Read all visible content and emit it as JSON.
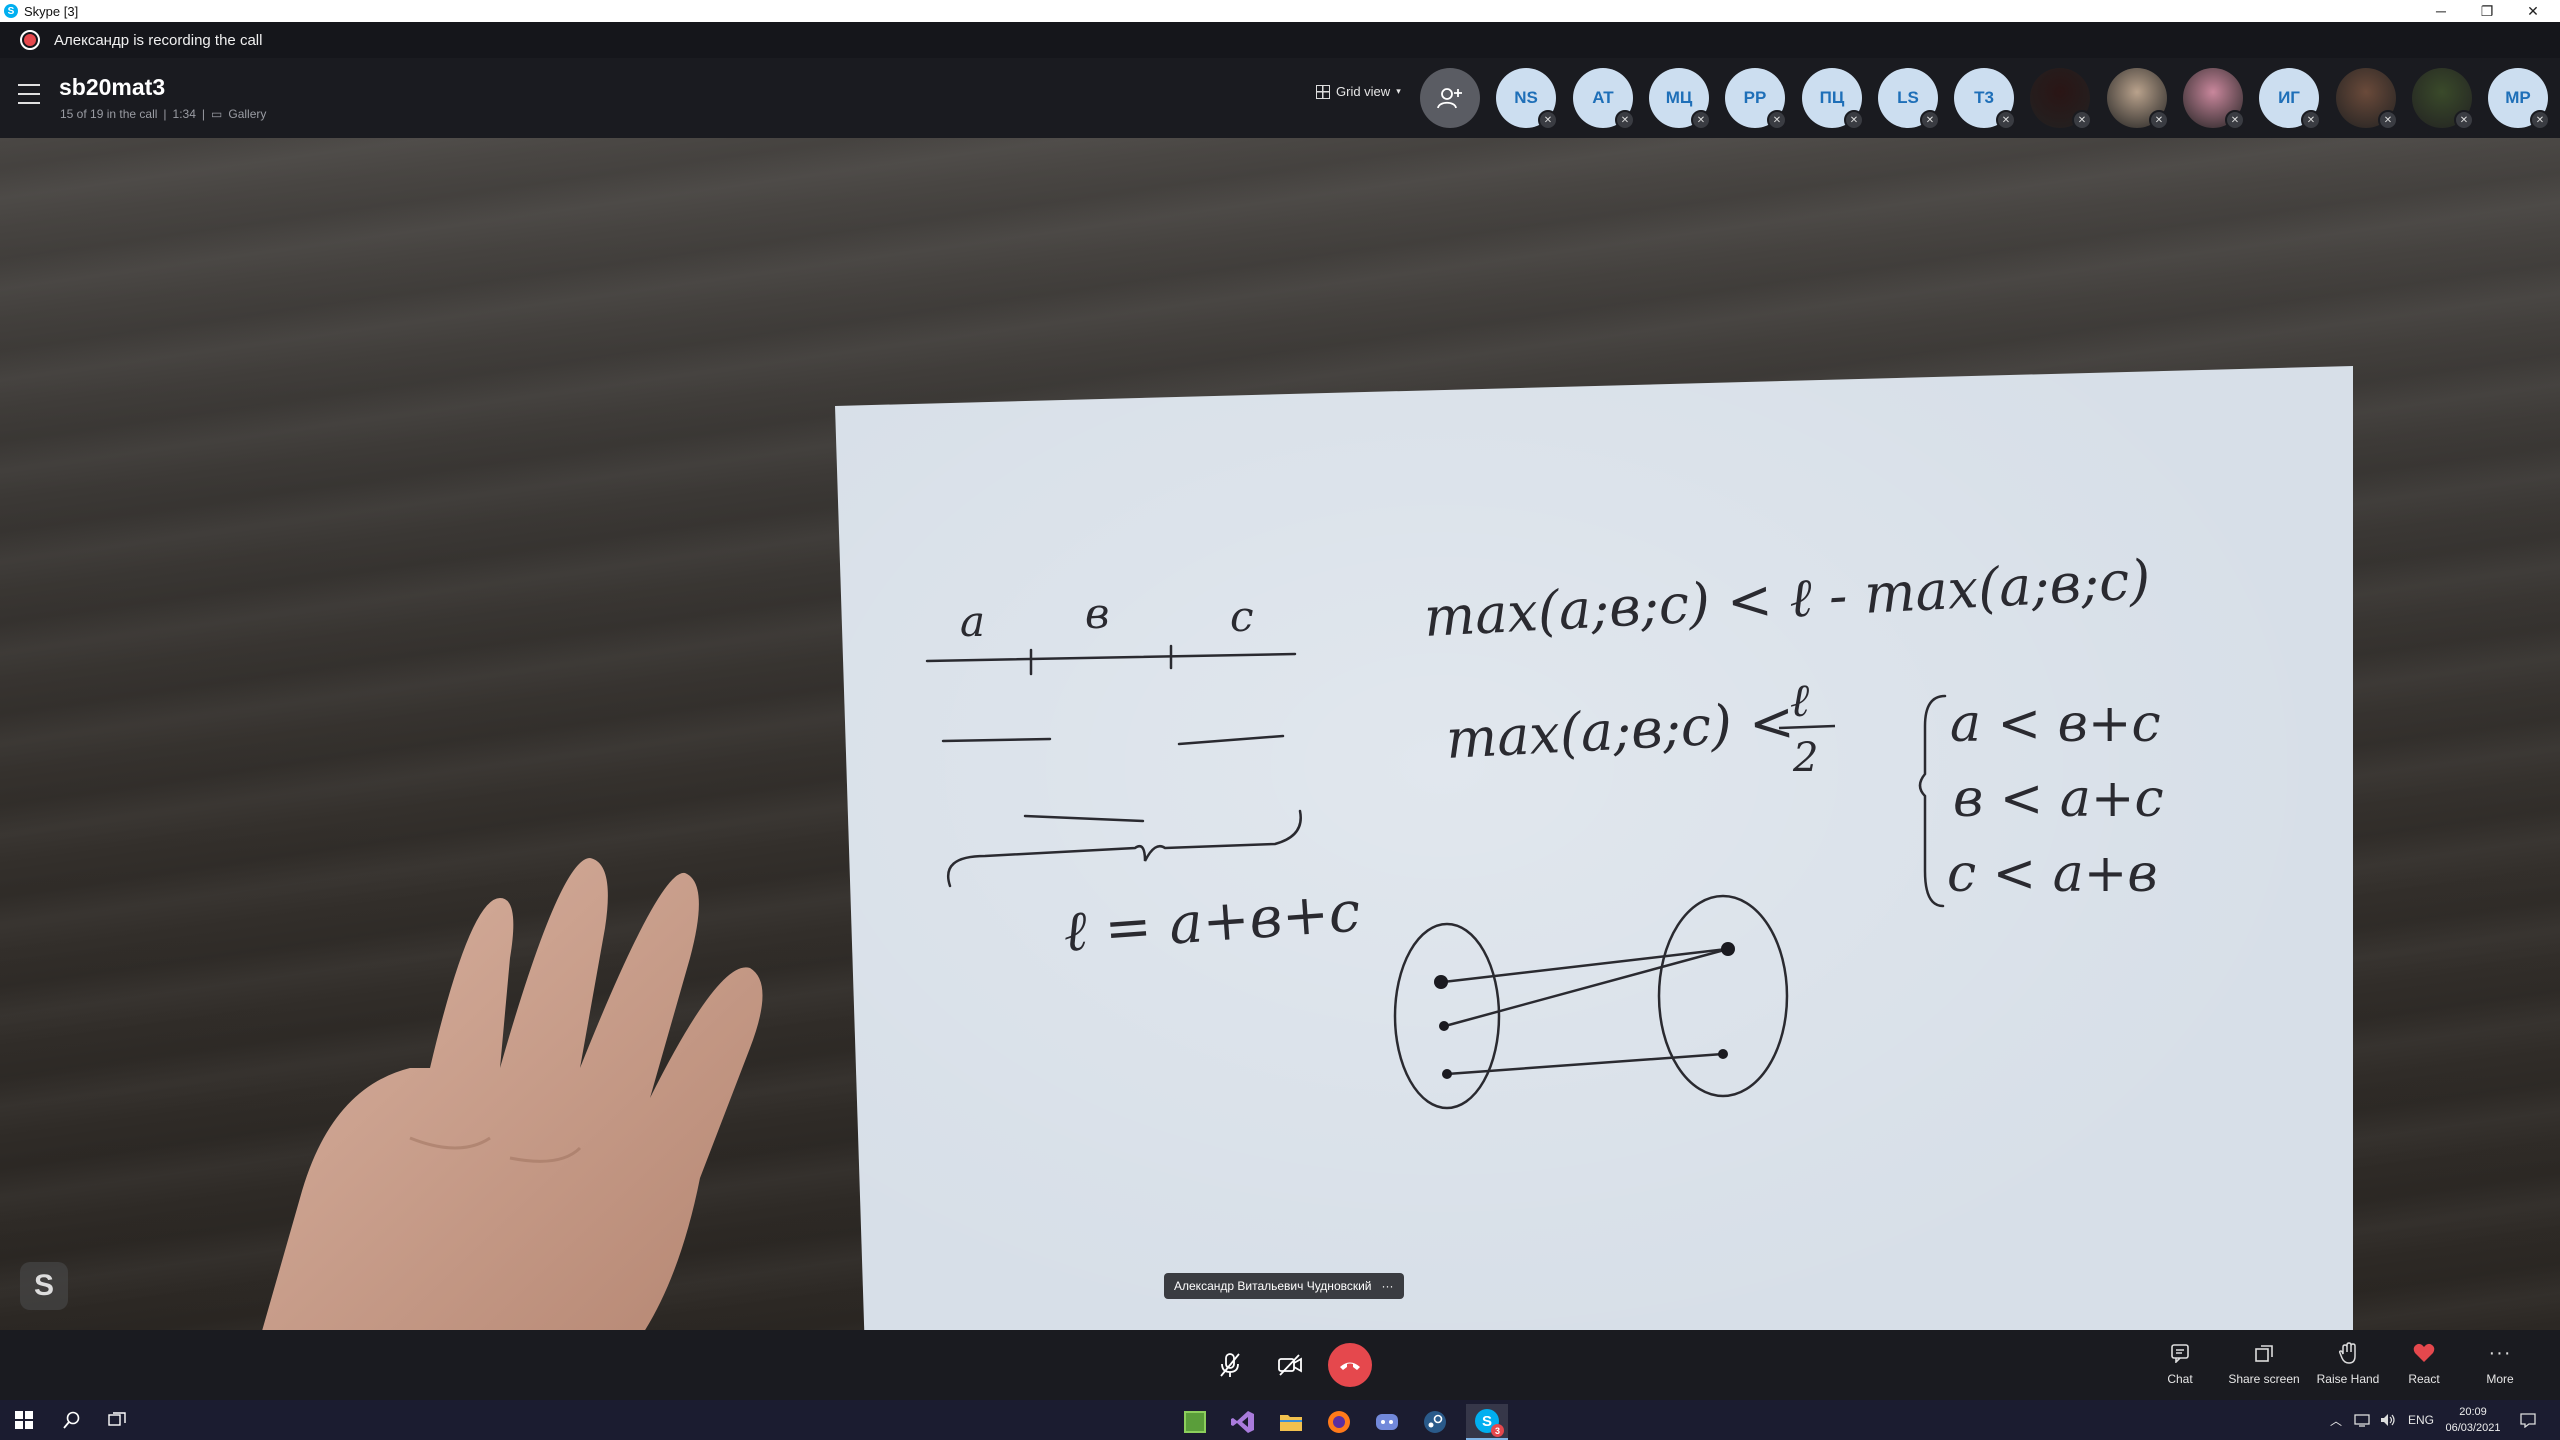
{
  "window": {
    "title": "Skype [3]",
    "minimize_glyph": "─",
    "restore_glyph": "❐",
    "close_glyph": "✕"
  },
  "recording_banner": {
    "text": "Александр is recording the call"
  },
  "call": {
    "title": "sb20mat3",
    "participants_status": "15 of 19 in the call",
    "duration": "1:34",
    "view_mode": "Gallery",
    "grid_view_label": "Grid view",
    "participants": [
      {
        "initials": "NS",
        "type": "initials"
      },
      {
        "initials": "AT",
        "type": "initials"
      },
      {
        "initials": "МЦ",
        "type": "initials"
      },
      {
        "initials": "PP",
        "type": "initials"
      },
      {
        "initials": "ПЦ",
        "type": "initials"
      },
      {
        "initials": "LS",
        "type": "initials"
      },
      {
        "initials": "T3",
        "type": "initials"
      },
      {
        "initials": "",
        "type": "photo",
        "color": "#2a1515"
      },
      {
        "initials": "",
        "type": "photo",
        "color": "#b9a28c"
      },
      {
        "initials": "",
        "type": "photo",
        "color": "#c9879c"
      },
      {
        "initials": "ИГ",
        "type": "initials"
      },
      {
        "initials": "",
        "type": "photo",
        "color": "#6a4a3a"
      },
      {
        "initials": "",
        "type": "photo",
        "color": "#3a4a2a"
      },
      {
        "initials": "MP",
        "type": "initials"
      }
    ]
  },
  "video": {
    "speaker_name": "Александр Витальевич Чудновский",
    "speaker_more": "···",
    "skype_badge": "S",
    "whiteboard": {
      "segment_labels": [
        "a",
        "в",
        "c"
      ],
      "equation_1": "max(a;в;c) < ℓ - max(a;в;c)",
      "equation_2": "max(a;в;c) <",
      "fraction_numerator": "ℓ",
      "fraction_denominator": "2",
      "perimeter": "ℓ = a+в+c",
      "system": [
        "a < в+c",
        "в < a+c",
        "c < a+в"
      ]
    }
  },
  "controls": {
    "chat": "Chat",
    "share_screen": "Share screen",
    "raise_hand": "Raise Hand",
    "react": "React",
    "more": "More"
  },
  "taskbar": {
    "language": "ENG",
    "time": "20:09",
    "date": "06/03/2021",
    "skype_badge_count": "3"
  },
  "colors": {
    "end_call": "#e5484d",
    "react_heart": "#e5484d",
    "avatar_text": "#1e6fb8",
    "avatar_bg": "#ccdef0"
  }
}
